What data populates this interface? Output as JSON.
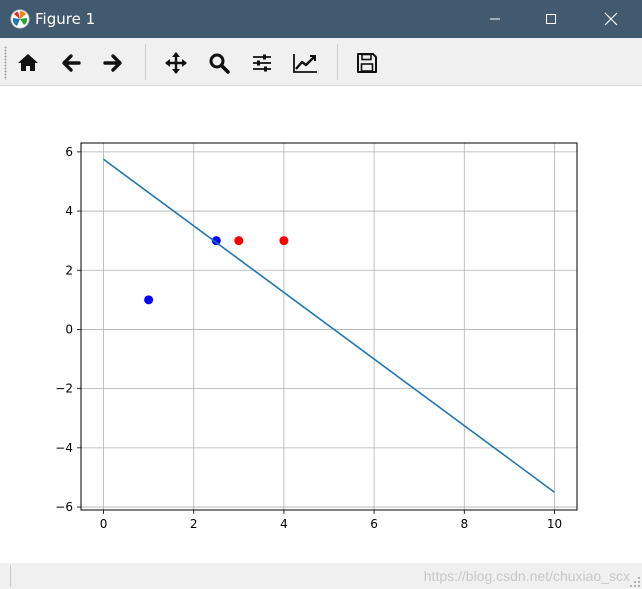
{
  "window": {
    "title": "Figure 1"
  },
  "toolbar": {
    "buttons": [
      {
        "id": "home",
        "icon": "home-icon"
      },
      {
        "id": "back",
        "icon": "arrow-left-icon"
      },
      {
        "id": "forward",
        "icon": "arrow-right-icon"
      },
      {
        "id": "pan",
        "icon": "move-icon"
      },
      {
        "id": "zoom",
        "icon": "magnifier-icon"
      },
      {
        "id": "subplots",
        "icon": "sliders-icon"
      },
      {
        "id": "customize",
        "icon": "line-chart-icon"
      },
      {
        "id": "save",
        "icon": "floppy-disk-icon"
      }
    ]
  },
  "chart_data": {
    "type": "scatter",
    "xlim": [
      -0.5,
      10.5
    ],
    "ylim": [
      -6.1,
      6.3
    ],
    "xticks": [
      0,
      2,
      4,
      6,
      8,
      10
    ],
    "xtick_labels": [
      "0",
      "2",
      "4",
      "6",
      "8",
      "10"
    ],
    "yticks": [
      6,
      4,
      2,
      0,
      -2,
      -4,
      -6
    ],
    "ytick_labels": [
      "6",
      "4",
      "2",
      "0",
      "−2",
      "−4",
      "−6"
    ],
    "grid": true,
    "series": [
      {
        "kind": "points",
        "color": "#0000ff",
        "points": [
          [
            1,
            1
          ],
          [
            2.5,
            3
          ]
        ]
      },
      {
        "kind": "points",
        "color": "#ff0000",
        "points": [
          [
            3,
            3
          ],
          [
            4,
            3
          ]
        ]
      },
      {
        "kind": "line",
        "color": "#1f77b4",
        "points": [
          [
            0,
            5.75
          ],
          [
            10,
            -5.5
          ]
        ]
      }
    ]
  },
  "statusbar": {
    "watermark": "https://blog.csdn.net/chuxiao_scx"
  }
}
